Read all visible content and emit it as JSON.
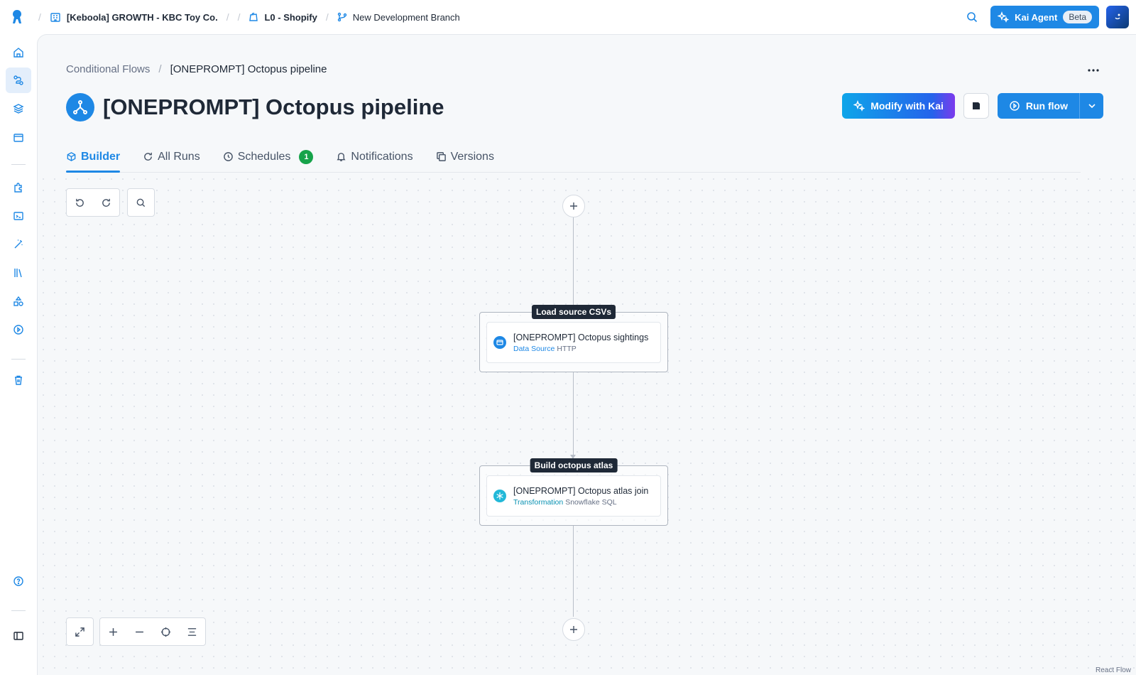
{
  "topbar": {
    "project": "[Keboola] GROWTH - KBC Toy Co.",
    "config": "L0 - Shopify",
    "branch": "New Development Branch",
    "kai_label": "Kai Agent",
    "kai_badge": "Beta"
  },
  "breadcrumb": {
    "parent": "Conditional Flows",
    "current": "[ONEPROMPT] Octopus pipeline"
  },
  "page": {
    "title": "[ONEPROMPT] Octopus pipeline",
    "modify_label": "Modify with Kai",
    "run_label": "Run flow"
  },
  "tabs": [
    {
      "label": "Builder",
      "active": true
    },
    {
      "label": "All Runs"
    },
    {
      "label": "Schedules",
      "count": "1"
    },
    {
      "label": "Notifications"
    },
    {
      "label": "Versions"
    }
  ],
  "phases": [
    {
      "label": "Load source CSVs",
      "task": {
        "name": "[ONEPROMPT] Octopus sightings",
        "type": "Data Source",
        "component": "HTTP"
      }
    },
    {
      "label": "Build octopus atlas",
      "task": {
        "name": "[ONEPROMPT] Octopus atlas join",
        "type": "Transformation",
        "component": "Snowflake SQL"
      }
    }
  ],
  "canvas": {
    "attribution": "React Flow"
  },
  "colors": {
    "accent": "#1e88e5",
    "badge_green": "#16a34a",
    "phase_label_bg": "#1f2937"
  }
}
